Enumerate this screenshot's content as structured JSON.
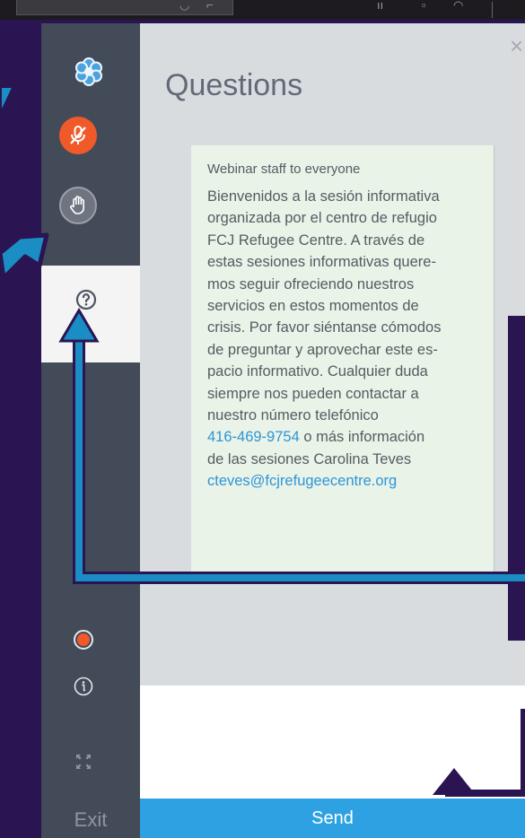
{
  "panel": {
    "title": "Questions",
    "close_glyph": "×"
  },
  "message": {
    "from": "Webinar staff to everyone",
    "body_lines": [
      "Bienvenidos a la sesión informativa",
      "organizada por el centro de refugio",
      "FCJ Refugee Centre. A través de",
      "estas sesiones informativas quere-",
      "mos seguir ofreciendo nuestros",
      "servicios en estos momentos de",
      "crisis. Por favor siéntanse cómodos",
      "de preguntar y aprovechar este es-",
      "pacio informativo. Cualquier duda",
      "siempre nos pueden contactar a",
      "nuestro número telefónico"
    ],
    "phone": "416-469-9754",
    "after_phone": " o más información",
    "line_sessions": "de las sesiones Carolina Teves",
    "email": "cteves@fcjrefugeecentre.org"
  },
  "sidebar": {
    "exit_label": "Exit",
    "icons": [
      "app-logo-icon",
      "microphone-muted-icon",
      "raise-hand-icon",
      "questions-icon",
      "record-icon",
      "info-icon",
      "expand-icon"
    ]
  },
  "composer": {
    "send_label": "Send"
  },
  "colors": {
    "annotation_frame": "#2a1452",
    "arrow_blue": "#1a8ec4",
    "mic_orange": "#f05a28",
    "send_blue": "#2ea1e2",
    "link_blue": "#2f95d6"
  }
}
